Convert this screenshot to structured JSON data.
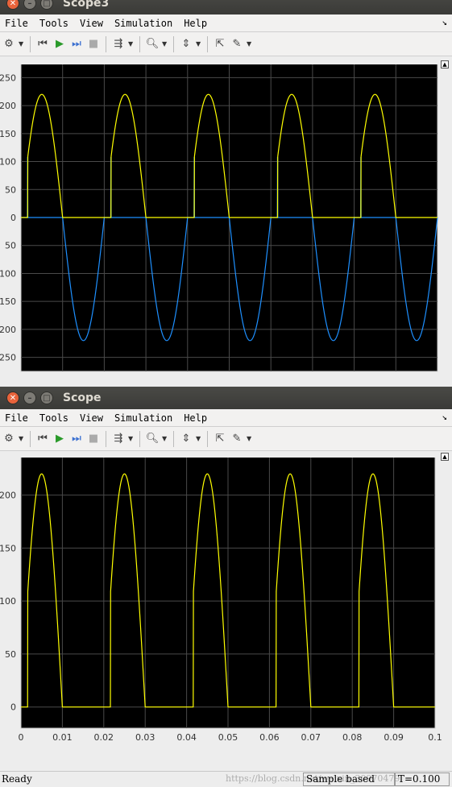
{
  "windows": [
    {
      "title": "Scope3",
      "menu": [
        "File",
        "Tools",
        "View",
        "Simulation",
        "Help"
      ],
      "yticks": [
        "250",
        "200",
        "150",
        "100",
        "50",
        "0",
        "50",
        "100",
        "150",
        "200",
        "250"
      ]
    },
    {
      "title": "Scope",
      "menu": [
        "File",
        "Tools",
        "View",
        "Simulation",
        "Help"
      ],
      "yticks": [
        "200",
        "150",
        "100",
        "50",
        "0"
      ],
      "xticks": [
        "0",
        "0.01",
        "0.02",
        "0.03",
        "0.04",
        "0.05",
        "0.06",
        "0.07",
        "0.08",
        "0.09",
        "0.1"
      ]
    }
  ],
  "status": {
    "ready": "Ready",
    "sample_mode": "Sample based",
    "time": "T=0.100",
    "watermark": "https://blog.csdn.net/weixin_30970479"
  },
  "colors": {
    "yellow": "#ffff00",
    "blue": "#1e90ff",
    "axes_bg": "#000000",
    "grid": "#4a4a4a"
  },
  "chart_data": [
    {
      "type": "line",
      "xlim": [
        0,
        0.1
      ],
      "ylim": [
        -275,
        275
      ],
      "grid": true,
      "series": [
        {
          "color": "yellow",
          "signal": "thyristor half-wave rectified sine, amplitude 220, firing at ~108, 50 Hz"
        },
        {
          "color": "blue",
          "signal": "negative half-cycle of sine, amplitude -220, step to ~108 at firing, 50 Hz"
        }
      ]
    },
    {
      "type": "line",
      "xlim": [
        0,
        0.1
      ],
      "ylim": [
        -20,
        240
      ],
      "grid": true,
      "series": [
        {
          "color": "yellow",
          "signal": "controlled half-wave rectified sine, amplitude 220, firing at ~108, 50 Hz"
        }
      ]
    }
  ]
}
